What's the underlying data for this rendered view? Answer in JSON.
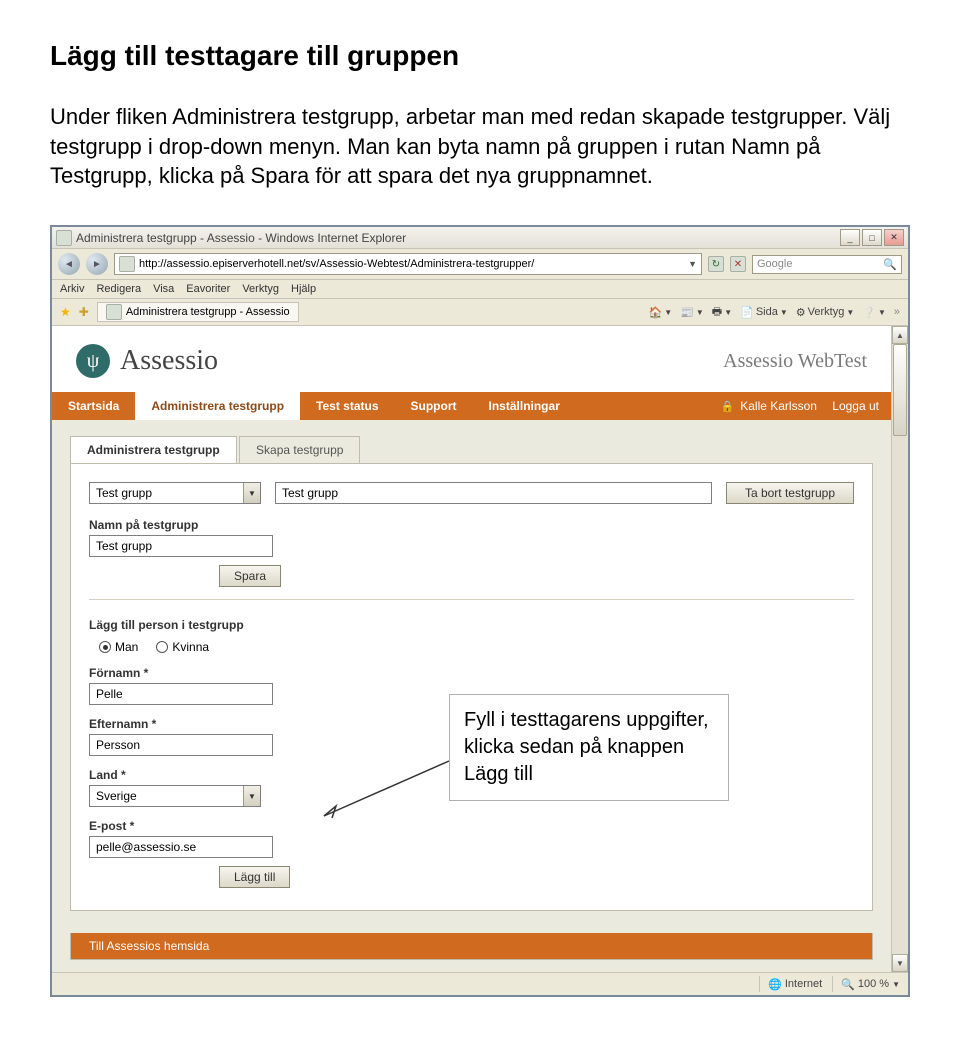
{
  "doc": {
    "heading": "Lägg till testtagare till gruppen",
    "intro": "Under fliken Administrera testgrupp, arbetar man med redan skapade testgrupper. Välj testgrupp i drop-down menyn. Man kan byta namn på gruppen i rutan Namn på Testgrupp, klicka på Spara för att spara det nya gruppnamnet."
  },
  "callout": {
    "text": "Fyll i testtagarens uppgifter, klicka sedan på knappen Lägg till"
  },
  "browser": {
    "title": "Administrera testgrupp - Assessio - Windows Internet Explorer",
    "url": "http://assessio.episerverhotell.net/sv/Assessio-Webtest/Administrera-testgrupper/",
    "search_placeholder": "Google",
    "menu": [
      "Arkiv",
      "Redigera",
      "Visa",
      "Eavoriter",
      "Verktyg",
      "Hjälp"
    ],
    "fav_tab": "Administrera testgrupp - Assessio",
    "tools": {
      "sida": "Sida",
      "verktyg": "Verktyg"
    },
    "status": {
      "left": "",
      "internet": "Internet",
      "zoom": "100 %"
    }
  },
  "page": {
    "brand": "Assessio",
    "webtest": "Assessio WebTest",
    "nav": {
      "items": [
        "Startsida",
        "Administrera testgrupp",
        "Test status",
        "Support",
        "Inställningar"
      ],
      "user": "Kalle Karlsson",
      "logout": "Logga ut"
    },
    "subtabs": {
      "active": "Administrera testgrupp",
      "other": "Skapa testgrupp"
    },
    "form": {
      "group_select": "Test grupp",
      "group_display": "Test grupp",
      "remove_btn": "Ta bort testgrupp",
      "name_label": "Namn på testgrupp",
      "name_value": "Test grupp",
      "save": "Spara",
      "add_person_heading": "Lägg till person i testgrupp",
      "gender": {
        "man": "Man",
        "kvinna": "Kvinna"
      },
      "firstname_label": "Förnamn *",
      "firstname_value": "Pelle",
      "lastname_label": "Efternamn *",
      "lastname_value": "Persson",
      "country_label": "Land *",
      "country_value": "Sverige",
      "email_label": "E-post *",
      "email_value": "pelle@assessio.se",
      "add_btn": "Lägg till"
    },
    "footer_link": "Till Assessios hemsida"
  }
}
